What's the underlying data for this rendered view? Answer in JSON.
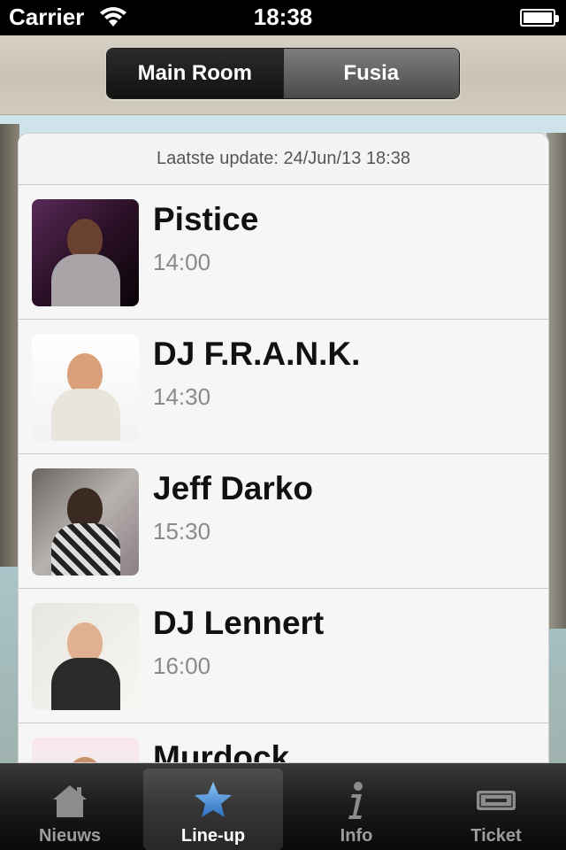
{
  "status_bar": {
    "carrier": "Carrier",
    "time": "18:38"
  },
  "segments": [
    {
      "label": "Main Room",
      "active": true
    },
    {
      "label": "Fusia",
      "active": false
    }
  ],
  "update_text": "Laatste update: 24/Jun/13 18:38",
  "lineup": [
    {
      "name": "Pistice",
      "time": "14:00"
    },
    {
      "name": "DJ F.R.A.N.K.",
      "time": "14:30"
    },
    {
      "name": "Jeff Darko",
      "time": "15:30"
    },
    {
      "name": "DJ Lennert",
      "time": "16:00"
    },
    {
      "name": "Murdock",
      "time": ""
    }
  ],
  "tabs": [
    {
      "label": "Nieuws",
      "icon": "house-icon",
      "selected": false
    },
    {
      "label": "Line-up",
      "icon": "star-icon",
      "selected": true
    },
    {
      "label": "Info",
      "icon": "info-icon",
      "selected": false
    },
    {
      "label": "Ticket",
      "icon": "ticket-icon",
      "selected": false
    }
  ],
  "colors": {
    "accent": "#4a90d9",
    "tab_inactive": "#9d9d9d"
  }
}
